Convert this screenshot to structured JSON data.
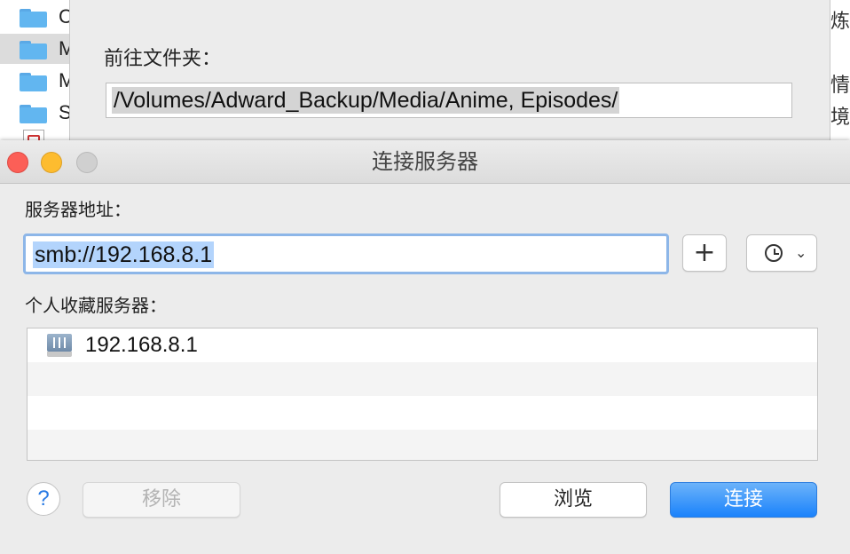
{
  "background_finder": {
    "rows": [
      {
        "name": "C",
        "icon": "folder-icon"
      },
      {
        "name": "M",
        "icon": "folder-icon",
        "selected": true
      },
      {
        "name": "M",
        "icon": "folder-icon"
      },
      {
        "name": "S",
        "icon": "folder-icon"
      },
      {
        "name": "",
        "icon": "document-icon"
      }
    ],
    "right_chars": [
      "炼",
      "情",
      "境"
    ]
  },
  "goto_folder": {
    "label": "前往文件夹：",
    "path_value": "/Volumes/Adward_Backup/Media/Anime, Episodes/"
  },
  "window": {
    "title": "连接服务器",
    "server_address_label": "服务器地址：",
    "server_address_value": "smb://192.168.8.1",
    "add_button_glyph": "+",
    "favorites_label": "个人收藏服务器：",
    "favorites": [
      {
        "name": "192.168.8.1",
        "icon": "server-icon"
      }
    ],
    "help_glyph": "?",
    "remove_label": "移除",
    "browse_label": "浏览",
    "connect_label": "连接",
    "accent_color": "#1a82fb"
  }
}
